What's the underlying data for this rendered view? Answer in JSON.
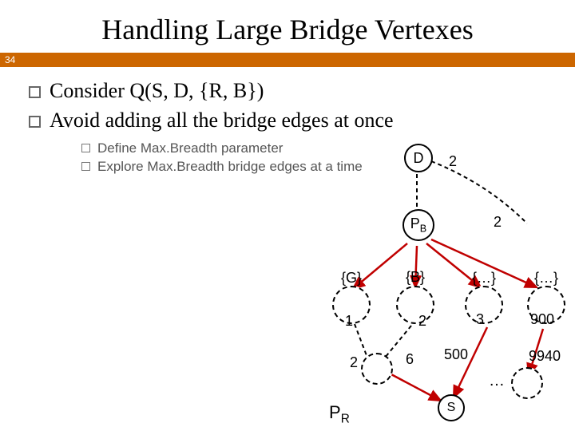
{
  "slide": {
    "title": "Handling Large Bridge Vertexes",
    "page_number": "34",
    "bullets": {
      "b1": "Consider Q(S, D, {R, B})",
      "b2": "Avoid adding all the bridge edges at once",
      "sub1": "Define Max.Breadth parameter",
      "sub2": "Explore Max.Breadth bridge edges at a time"
    }
  },
  "diagram": {
    "labels": {
      "D": "D",
      "PB": "P",
      "PB_sub": "B",
      "G": "{G}",
      "B": "{B}",
      "dots1": "{…}",
      "dots2": "{…}",
      "ellipsis": "…",
      "S": "S",
      "PR": "P",
      "PR_sub": "R"
    },
    "edge_weights": {
      "d_pb": "2",
      "pb_unknown": "2",
      "g_1": "1",
      "b_2": "2",
      "d1_3": "3",
      "d2_900": "900",
      "g_low": "2",
      "six": "6",
      "fivehundred": "500",
      "nine940": "9940"
    }
  }
}
